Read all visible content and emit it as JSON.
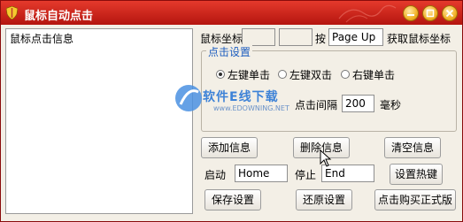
{
  "window": {
    "title": "鼠标自动点击"
  },
  "list": {
    "header": "鼠标点击信息"
  },
  "coords": {
    "label": "鼠标坐标",
    "x": "",
    "y": "",
    "press_label": "按",
    "hotkey": "Page Up",
    "suffix": "获取鼠标坐标"
  },
  "click_settings": {
    "title": "点击设置",
    "options": [
      "左键单击",
      "左键双击",
      "右键单击"
    ],
    "selected_index": 0,
    "interval_label": "点击间隔",
    "interval_value": "200",
    "interval_unit": "毫秒"
  },
  "buttons": {
    "add": "添加信息",
    "delete": "删除信息",
    "clear": "清空信息",
    "set_hotkey": "设置热键",
    "save": "保存设置",
    "restore": "还原设置",
    "buy": "点击购买正式版"
  },
  "hotkeys": {
    "start_label": "启动",
    "start_value": "Home",
    "stop_label": "停止",
    "stop_value": "End"
  },
  "watermark": {
    "text": "软件E线下载",
    "url": "www.EDOWNING.NET"
  },
  "colors": {
    "titlebar": "#c41f16",
    "group_title": "#1c5dbf"
  }
}
